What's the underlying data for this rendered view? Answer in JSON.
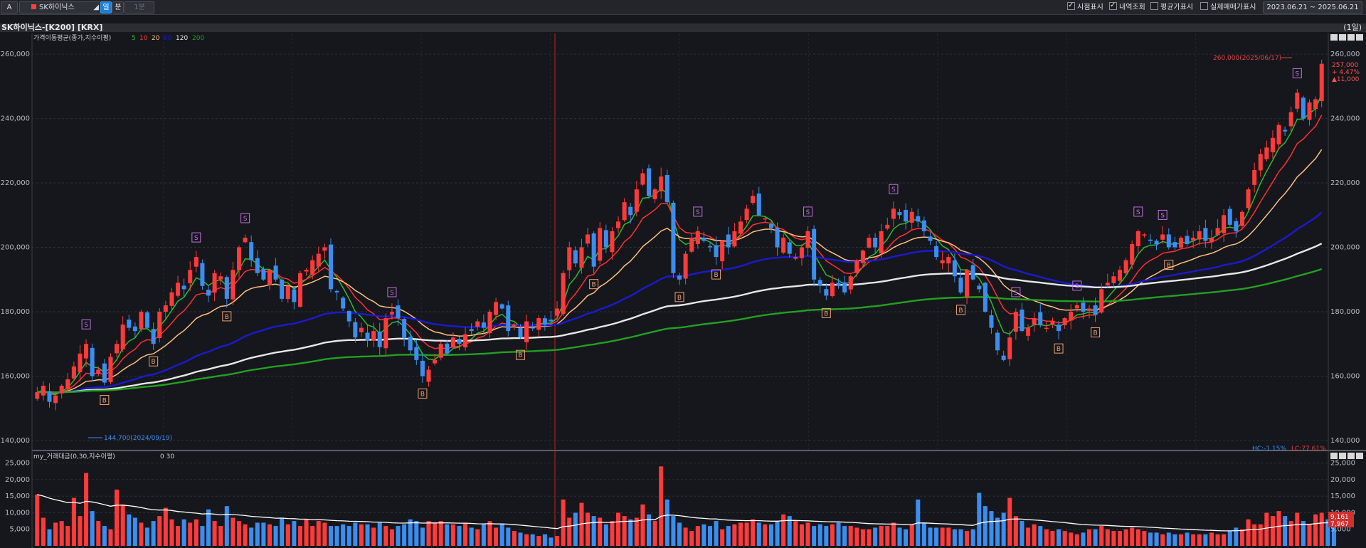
{
  "toolbar": {
    "code_box": "A",
    "stock_name": "SK하이닉스",
    "period_buttons": [
      "일",
      "분",
      "1분"
    ],
    "checkboxes": [
      {
        "label": "시점표시",
        "checked": true
      },
      {
        "label": "내역조회",
        "checked": true
      },
      {
        "label": "평균가표시",
        "checked": false
      },
      {
        "label": "실제매매가표시",
        "checked": false
      }
    ],
    "date_range": "2023.06.21 ~ 2025.06.21"
  },
  "chart_title": "SK하이닉스-[K200] [KRX]",
  "period_label": "(1일)",
  "legend": {
    "prefix": "가격이동평균(종가,지수이평)",
    "items": [
      {
        "label": "5",
        "color": "#2eb82e"
      },
      {
        "label": "10",
        "color": "#ff3030"
      },
      {
        "label": "20",
        "color": "#ffc080"
      },
      {
        "label": "60",
        "color": "#1a1ad0"
      },
      {
        "label": "120",
        "color": "#e8e8e8"
      },
      {
        "label": "200",
        "color": "#22a022"
      }
    ]
  },
  "volume_legend": {
    "prefix": "my_거래대금(0,30,지수이평)",
    "values": "0  30"
  },
  "price_axis": {
    "ticks": [
      "260,000",
      "240,000",
      "220,000",
      "200,000",
      "180,000",
      "160,000",
      "140,000"
    ]
  },
  "volume_axis": {
    "ticks": [
      "25,000",
      "20,000",
      "15,000",
      "10,000",
      "5,000"
    ]
  },
  "annotations": {
    "high": "260,000(2025/06/17)",
    "low": "144,700(2024/09/19)",
    "last_price": "257,000",
    "change_pct": "+ 4.47%",
    "change": "▲11,000",
    "hc_label": "HC:-1.15%",
    "lc_label": "LC:77.61%",
    "vol_last1": "9,161",
    "vol_last2": "7,967"
  },
  "colors": {
    "up": "#ff3a3a",
    "down": "#3a8ef0",
    "bg": "#16171c",
    "signal_s": "#c070e0",
    "signal_b": "#f0a070"
  },
  "chart_data": {
    "type": "candlestick",
    "ylim": [
      138000,
      264000
    ],
    "volume_ylim": [
      0,
      26000
    ],
    "closes": [
      155000,
      157000,
      152000,
      154000,
      157000,
      159000,
      163000,
      167000,
      170000,
      160000,
      162000,
      158000,
      166000,
      170000,
      176000,
      175000,
      174000,
      180000,
      175000,
      170000,
      180000,
      182000,
      186000,
      189000,
      187000,
      193000,
      197000,
      188000,
      185000,
      192000,
      191000,
      184000,
      193000,
      200000,
      203000,
      196000,
      192000,
      190000,
      193000,
      190000,
      184000,
      188000,
      183000,
      192000,
      193000,
      196000,
      198000,
      200000,
      187000,
      186000,
      181000,
      177000,
      172000,
      175000,
      171000,
      174000,
      169000,
      178000,
      180000,
      178000,
      172000,
      168000,
      165000,
      160000,
      162000,
      165000,
      170000,
      167000,
      172000,
      170000,
      173000,
      174000,
      177000,
      175000,
      180000,
      183000,
      181000,
      174000,
      176000,
      172000,
      177000,
      175000,
      178000,
      176000,
      177000,
      181000,
      192000,
      200000,
      195000,
      200000,
      204000,
      194000,
      206000,
      200000,
      205000,
      208000,
      214000,
      210000,
      218000,
      223000,
      216000,
      218000,
      222000,
      214000,
      192000,
      190000,
      198000,
      203000,
      205000,
      202000,
      200000,
      197000,
      202000,
      200000,
      205000,
      208000,
      212000,
      216000,
      210000,
      209000,
      206000,
      200000,
      203000,
      198000,
      197000,
      200000,
      205000,
      190000,
      188000,
      185000,
      189000,
      188000,
      186000,
      191000,
      196000,
      199000,
      203000,
      200000,
      205000,
      207000,
      212000,
      210000,
      208000,
      211000,
      208000,
      205000,
      202000,
      197000,
      196000,
      197000,
      191000,
      186000,
      193000,
      190000,
      187000,
      180000,
      175000,
      168000,
      165000,
      172000,
      180000,
      174000,
      175000,
      178000,
      176000,
      175000,
      177000,
      174000,
      178000,
      180000,
      182000,
      180000,
      181000,
      179000,
      187000,
      189000,
      191000,
      193000,
      196000,
      201000,
      205000,
      204000,
      202000,
      201000,
      204000,
      200000,
      200000,
      203000,
      201000,
      203000,
      205000,
      202000,
      203000,
      206000,
      210000,
      207000,
      205000,
      211000,
      218000,
      224000,
      229000,
      231000,
      234000,
      238000,
      236000,
      242000,
      248000,
      240000,
      245000,
      246000,
      257000
    ],
    "high": 260000,
    "high_date": "2025/06/17",
    "low": 144700,
    "low_date": "2024/09/19",
    "volumes": [
      15500,
      8500,
      5000,
      7000,
      7500,
      6000,
      14500,
      9000,
      22000,
      10500,
      7500,
      6000,
      5000,
      17000,
      12500,
      9500,
      8500,
      7000,
      5500,
      7500,
      9000,
      11500,
      8000,
      6000,
      8000,
      7000,
      8000,
      6000,
      11000,
      7500,
      6000,
      12000,
      8500,
      7500,
      6500,
      5500,
      7000,
      7000,
      6500,
      6000,
      8500,
      6500,
      7500,
      6000,
      8000,
      6000,
      7500,
      7000,
      6000,
      6000,
      6500,
      6000,
      7000,
      6500,
      6500,
      5500,
      7000,
      6000,
      5000,
      6000,
      6500,
      8000,
      7500,
      5500,
      7500,
      7000,
      7500,
      6500,
      6500,
      6000,
      7000,
      5500,
      5000,
      6500,
      7500,
      5500,
      6500,
      5500,
      4500,
      4000,
      3500,
      3500,
      3000,
      3500,
      2500,
      3000,
      14000,
      8500,
      10000,
      13000,
      10000,
      9000,
      8500,
      6500,
      7500,
      10000,
      9000,
      8000,
      8500,
      12500,
      9500,
      7500,
      24000,
      14000,
      9000,
      7000,
      5500,
      4500,
      6000,
      6500,
      6000,
      7500,
      5000,
      6000,
      6500,
      7000,
      7000,
      8000,
      7000,
      6500,
      6500,
      7500,
      9500,
      9000,
      7500,
      6500,
      7000,
      6000,
      6500,
      6000,
      6500,
      7000,
      6000,
      6000,
      5500,
      5000,
      5000,
      5500,
      6000,
      6000,
      7000,
      5500,
      5000,
      6500,
      14000,
      7000,
      5500,
      5500,
      5500,
      5500,
      5000,
      5000,
      4500,
      5000,
      16000,
      12000,
      10500,
      8500,
      10000,
      14500,
      9000,
      7500,
      5500,
      6500,
      6000,
      5000,
      4500,
      5000,
      4500,
      4000,
      3500,
      4000,
      5000,
      5000,
      6000,
      5000,
      4500,
      4500,
      5000,
      5500,
      5000,
      4500,
      4000,
      4000,
      3500,
      4000,
      3500,
      3500,
      4000,
      3500,
      3500,
      3500,
      4000,
      3500,
      3500,
      4500,
      5500,
      5000,
      8000,
      6500,
      6500,
      10000,
      9000,
      10500,
      9000,
      7500,
      10000,
      7500,
      6500,
      9500,
      10000,
      8000,
      9000
    ]
  }
}
